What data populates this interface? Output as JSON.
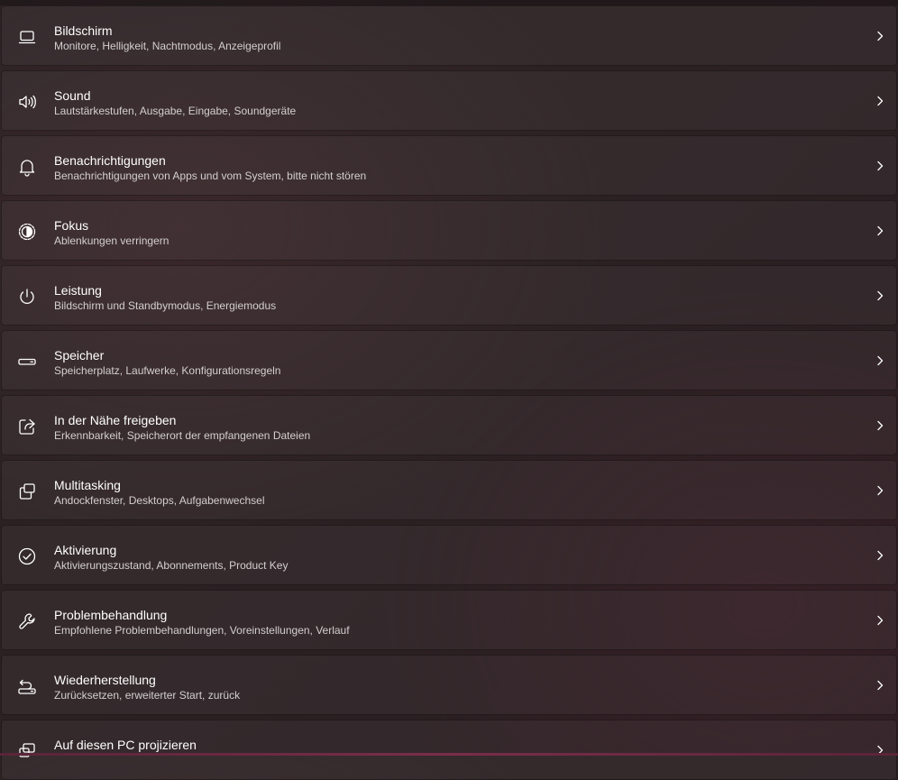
{
  "settings": {
    "items": [
      {
        "title": "Bildschirm",
        "subtitle": "Monitore, Helligkeit, Nachtmodus, Anzeigeprofil",
        "icon": "display-icon"
      },
      {
        "title": "Sound",
        "subtitle": "Lautstärkestufen, Ausgabe, Eingabe, Soundgeräte",
        "icon": "speaker-icon"
      },
      {
        "title": "Benachrichtigungen",
        "subtitle": "Benachrichtigungen von Apps und vom System, bitte nicht stören",
        "icon": "bell-icon"
      },
      {
        "title": "Fokus",
        "subtitle": "Ablenkungen verringern",
        "icon": "focus-icon"
      },
      {
        "title": "Leistung",
        "subtitle": "Bildschirm und Standbymodus, Energiemodus",
        "icon": "power-icon"
      },
      {
        "title": "Speicher",
        "subtitle": "Speicherplatz, Laufwerke, Konfigurationsregeln",
        "icon": "storage-icon"
      },
      {
        "title": "In der Nähe freigeben",
        "subtitle": "Erkennbarkeit, Speicherort der empfangenen Dateien",
        "icon": "share-icon"
      },
      {
        "title": "Multitasking",
        "subtitle": "Andockfenster, Desktops, Aufgabenwechsel",
        "icon": "multitasking-icon"
      },
      {
        "title": "Aktivierung",
        "subtitle": "Aktivierungszustand, Abonnements, Product Key",
        "icon": "checkmark-circle-icon"
      },
      {
        "title": "Problembehandlung",
        "subtitle": "Empfohlene Problembehandlungen, Voreinstellungen, Verlauf",
        "icon": "wrench-icon"
      },
      {
        "title": "Wiederherstellung",
        "subtitle": "Zurücksetzen, erweiterter Start, zurück",
        "icon": "recovery-icon"
      },
      {
        "title": "Auf diesen PC projizieren",
        "subtitle": "",
        "icon": "project-icon"
      }
    ]
  },
  "colors": {
    "card_background": "#ffffff0b",
    "title_text": "#ffffff",
    "subtitle_text": "#d3cfd0"
  }
}
